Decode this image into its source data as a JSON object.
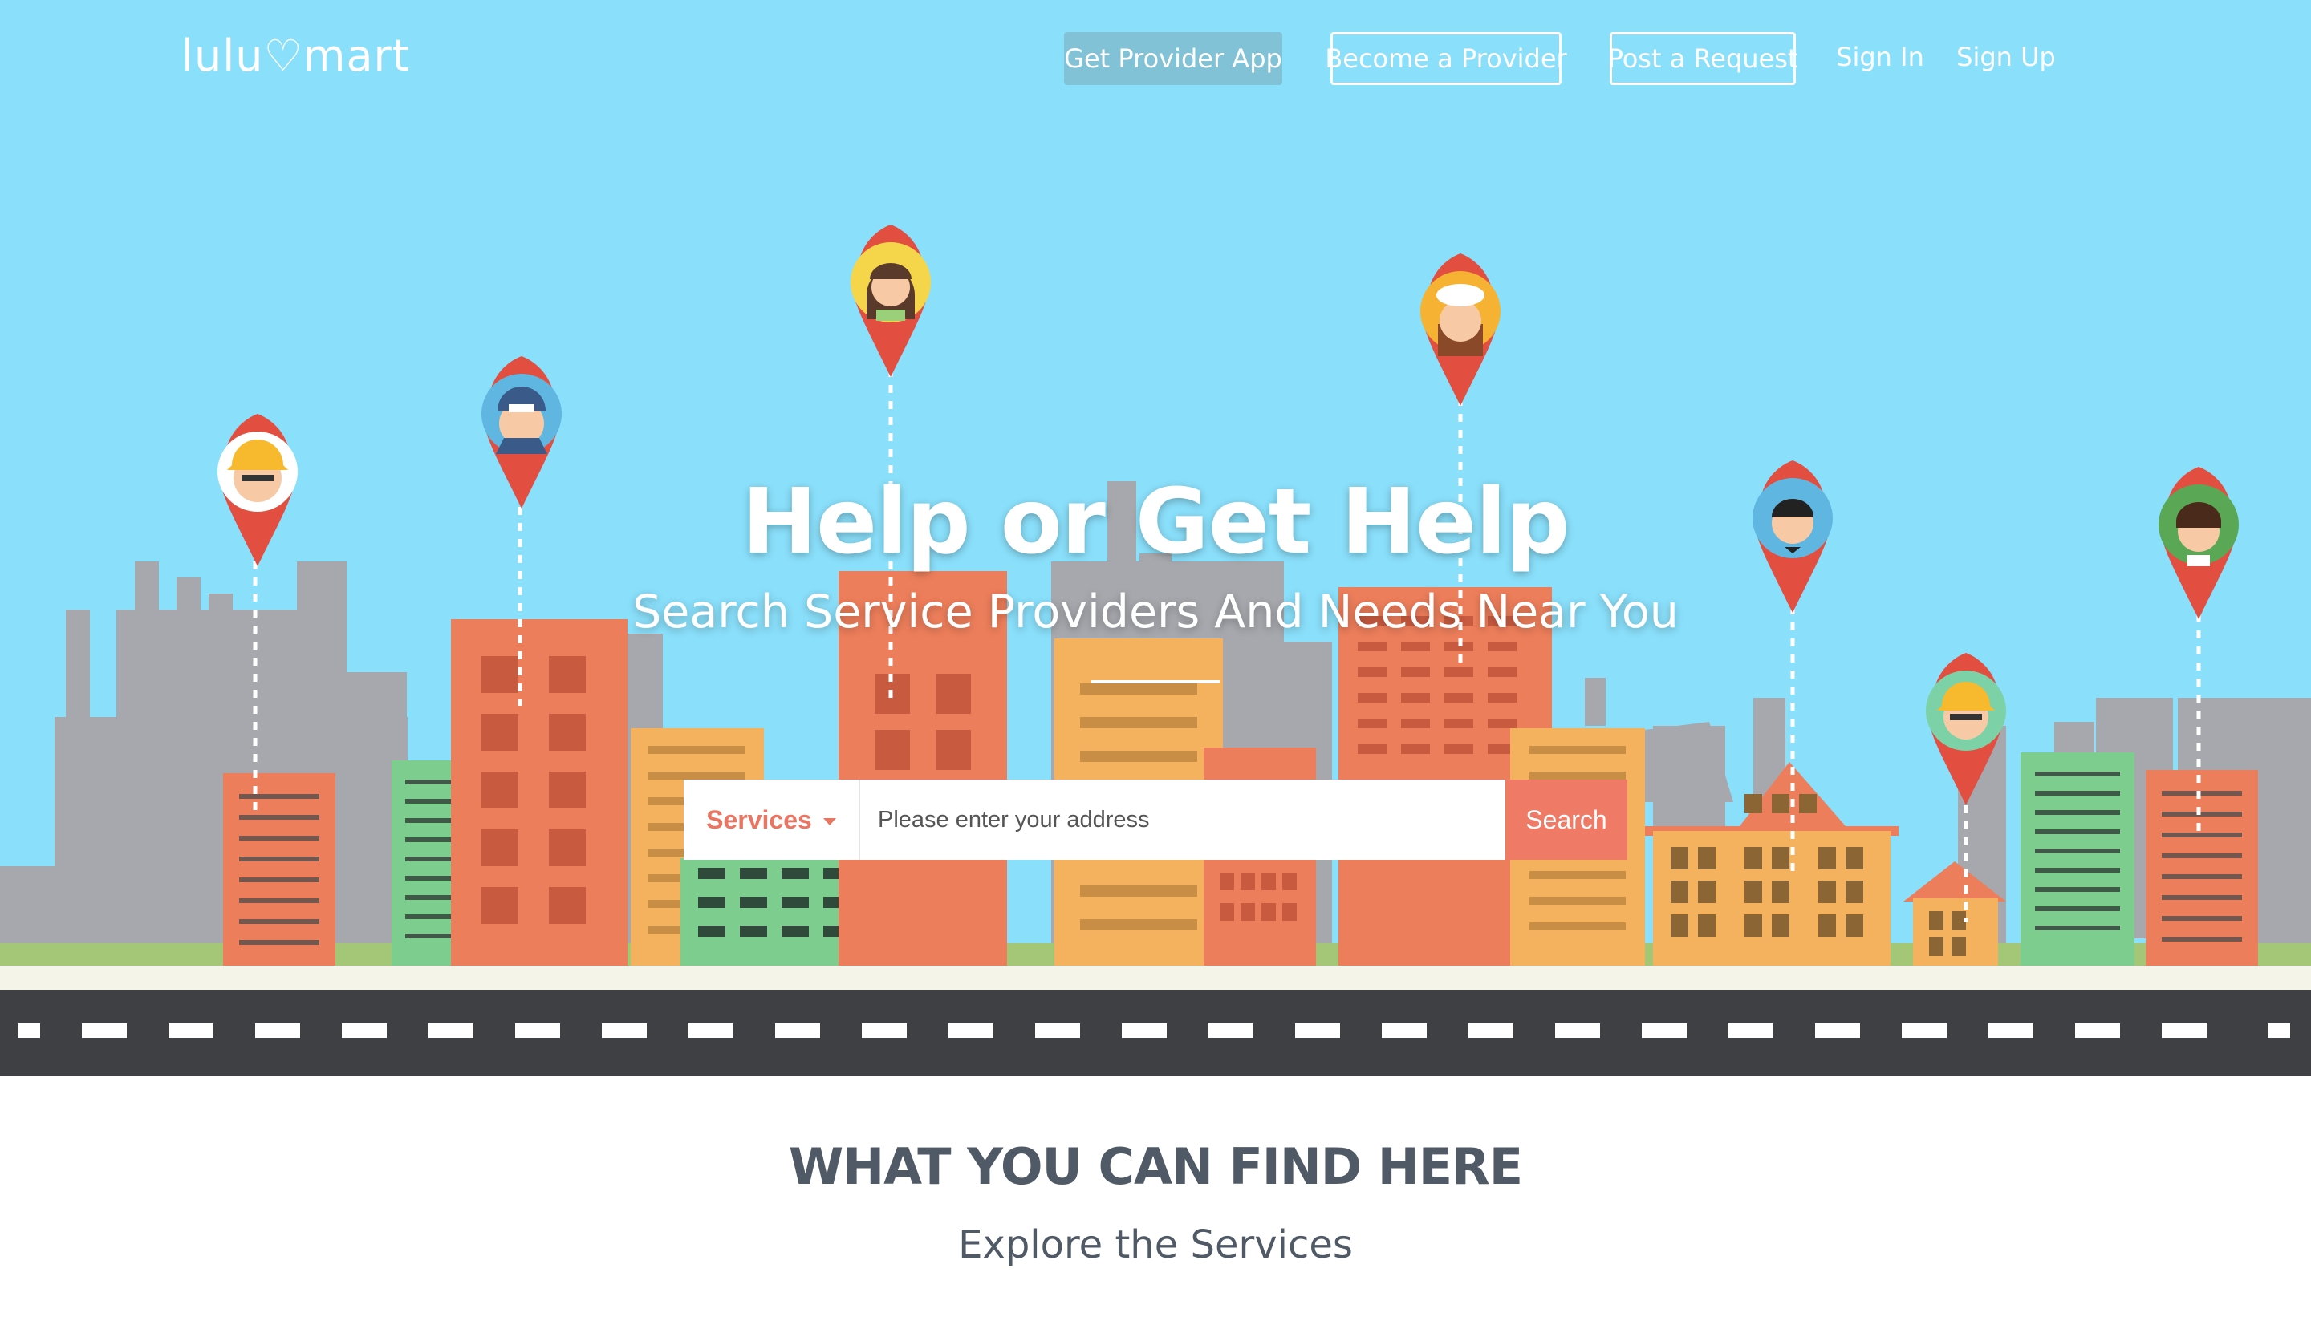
{
  "brand": {
    "logo_text": "lulu♡mart"
  },
  "nav": {
    "get_provider_app": "Get Provider App",
    "become_provider": "Become a Provider",
    "post_request": "Post a Request",
    "sign_in": "Sign In",
    "sign_up": "Sign Up"
  },
  "hero": {
    "title": "Help or Get Help",
    "subtitle": "Search Service Providers And Needs Near You"
  },
  "search": {
    "category": "Services",
    "address_placeholder": "Please enter your address",
    "address_value": "",
    "button": "Search"
  },
  "section": {
    "title": "WHAT YOU CAN FIND HERE",
    "subtitle": "Explore the Services"
  },
  "colors": {
    "sky": "#8adffa",
    "accent": "#ef7b67",
    "pin_red": "#e24f41",
    "road": "#3f4044",
    "text_dark": "#505a66"
  }
}
